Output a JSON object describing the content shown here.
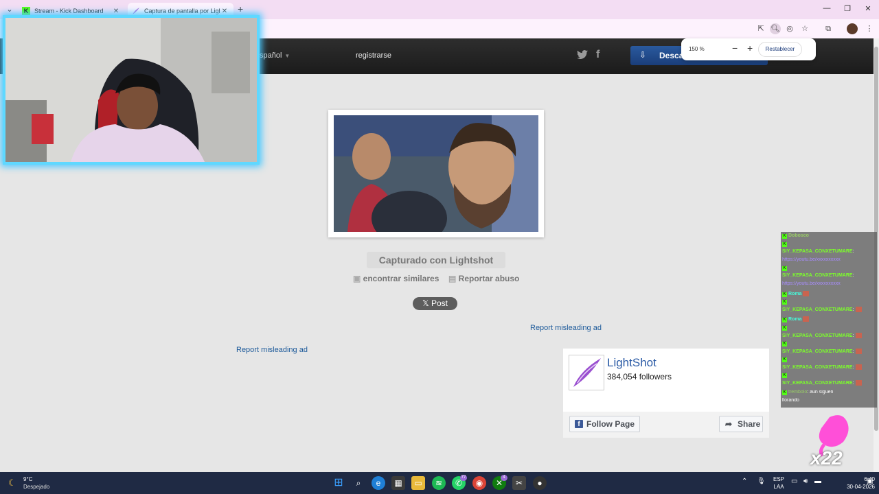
{
  "browser": {
    "tabs": [
      {
        "title": "Stream - Kick Dashboard",
        "favicon_color": "#53fc18"
      },
      {
        "title": "Captura de pantalla por Lightsh",
        "favicon_color": "#b06ad8"
      }
    ],
    "new_tab": "+",
    "zoom": {
      "percent": "150 %",
      "minus": "−",
      "plus": "+",
      "reset_label": "Restablecer"
    }
  },
  "site": {
    "language": "spañol",
    "register": "registrarse",
    "download": "Desca",
    "captured_with": "Capturado con Lightshot",
    "find_similar": "encontrar similares",
    "report_abuse": "Reportar abuso",
    "post_button": "Post",
    "ad_link_1": "Report misleading ad",
    "ad_link_2": "Report misleading ad"
  },
  "facebook_widget": {
    "page_name": "LightShot",
    "followers": "384,054 followers",
    "follow_label": "Follow Page",
    "share_label": "Share"
  },
  "chat": {
    "messages": [
      {
        "user": "Dobosco",
        "text": ""
      },
      {
        "user": "",
        "text": ""
      },
      {
        "user": "SIY_KEPASA_CONXETUMARE",
        "text": ":"
      },
      {
        "user": "",
        "text": "https://youtu.be/xxxxxxxxxx",
        "kind": "link"
      },
      {
        "user": "",
        "text": ""
      },
      {
        "user": "SIY_KEPASA_CONXETUMARE",
        "text": ":"
      },
      {
        "user": "",
        "text": "https://youtu.be/xxxxxxxxxx",
        "kind": "link"
      },
      {
        "user": "Roma",
        "text": ""
      },
      {
        "user": "",
        "text": ""
      },
      {
        "user": "SIY_KEPASA_CONXETUMARE",
        "text": ":"
      },
      {
        "user": "Roma",
        "text": ""
      },
      {
        "user": "",
        "text": ""
      },
      {
        "user": "SIY_KEPASA_CONXETUMARE",
        "text": ":"
      },
      {
        "user": "",
        "text": ""
      },
      {
        "user": "SIY_KEPASA_CONXETUMARE",
        "text": ":"
      },
      {
        "user": "",
        "text": ""
      },
      {
        "user": "SIY_KEPASA_CONXETUMARE",
        "text": ":"
      },
      {
        "user": "",
        "text": ""
      },
      {
        "user": "SIY_KEPASA_CONXETUMARE",
        "text": ":"
      },
      {
        "user": "trembolo",
        "text": ": aun siguen"
      },
      {
        "user": "",
        "text": "llorando"
      }
    ]
  },
  "overlay": {
    "combo_count": "x22"
  },
  "taskbar": {
    "temperature": "9°C",
    "weather": "Despejado",
    "badges": {
      "whatsapp": "77",
      "xbox": "4"
    },
    "language_top": "ESP",
    "language_bottom": "LAA",
    "time": "6:40",
    "date": "30-04-2026"
  }
}
